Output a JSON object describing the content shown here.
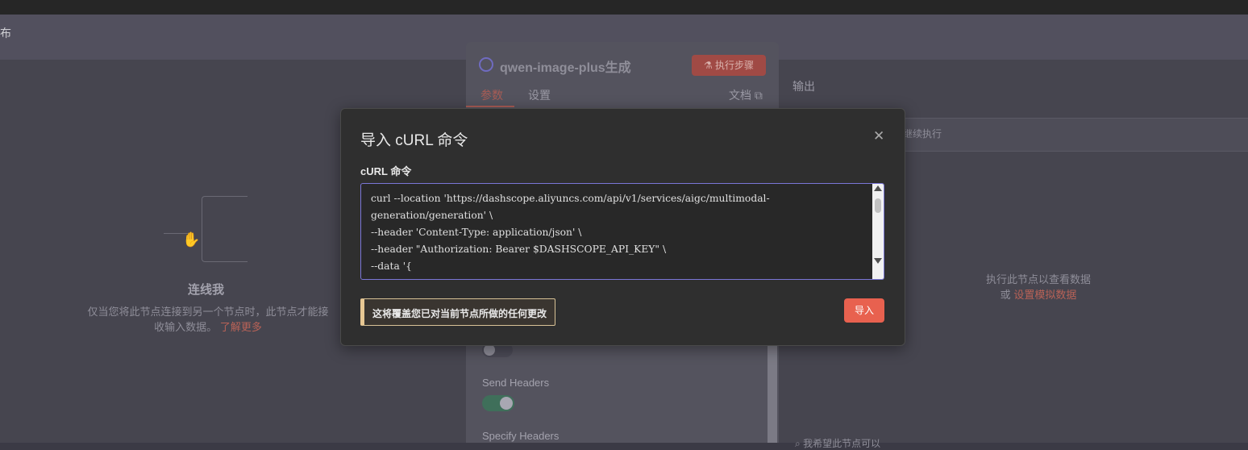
{
  "background": {
    "header_cut_text": "布",
    "canvas": {
      "connect_title": "连线我",
      "connect_desc": "仅当您将此节点连接到另一个节点时，此节点才能接收输入数据。",
      "connect_link": "了解更多"
    },
    "node": {
      "title": "qwen-image-plus生成",
      "exec_button": "执行步骤",
      "tabs": [
        "参数",
        "设置"
      ],
      "docs_link": "文档",
      "send_headers_label": "Send Headers",
      "specify_headers_label": "Specify Headers"
    },
    "output": {
      "title": "输出",
      "strip_text": "继续执行",
      "run_hint": "执行此节点以查看数据",
      "run_hint_prefix": "或",
      "run_hint_link": "设置模拟数据",
      "bottom_hint": "我希望此节点可以"
    }
  },
  "modal": {
    "title": "导入 cURL 命令",
    "field_label": "cURL 命令",
    "curl_text": "curl --location 'https://dashscope.aliyuncs.com/api/v1/services/aigc/multimodal-generation/generation' \\\n--header 'Content-Type: application/json' \\\n--header \"Authorization: Bearer $DASHSCOPE_API_KEY\" \\\n--data '{\n    \"model\": \"qwen-image-plus\",",
    "warning": "这将覆盖您已对当前节点所做的任何更改",
    "import_button": "导入",
    "close_icon": "close-icon"
  },
  "colors": {
    "accent": "#e8614f",
    "warning_border": "#e8c893",
    "focus_border": "#7a76d6"
  }
}
